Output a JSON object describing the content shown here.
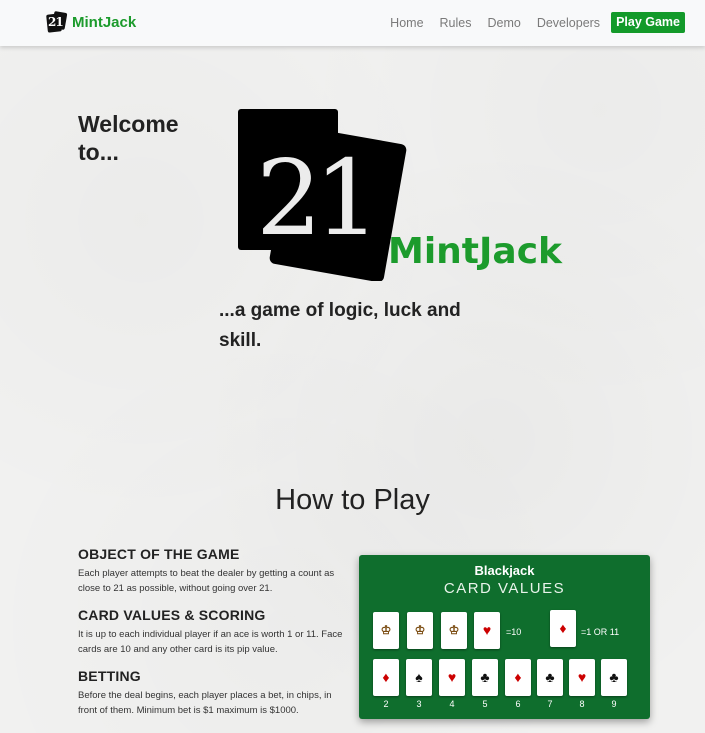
{
  "navbar": {
    "brand_logo_text": "21",
    "brand_name": "MintJack",
    "links": [
      "Home",
      "Rules",
      "Demo",
      "Developers"
    ],
    "cta": "Play Game"
  },
  "hero": {
    "welcome": "Welcome to...",
    "logo_number": "21",
    "logo_name": "MintJack",
    "tagline": "...a game of logic, luck and skill."
  },
  "how_to_play": {
    "title": "How to Play",
    "rules": [
      {
        "heading": "OBJECT OF THE GAME",
        "text": "Each player attempts to beat the dealer by getting a count as close to 21 as possible, without going over 21."
      },
      {
        "heading": "CARD VALUES & SCORING",
        "text": "It is up to each individual player if an ace is worth 1 or 11. Face cards are 10 and any other card is its pip value."
      },
      {
        "heading": "BETTING",
        "text": "Before the deal begins, each player places a bet, in chips, in front of them. Minimum bet is $1 maximum is $1000."
      }
    ]
  },
  "card_panel": {
    "title": "Blackjack",
    "subtitle": "CARD VALUES",
    "face_value_label": "=10",
    "ace_value_label": "=1 OR 11",
    "pip_labels": [
      "2",
      "3",
      "4",
      "5",
      "6",
      "7",
      "8",
      "9"
    ],
    "colors": {
      "panel": "#0f6e2d",
      "brand_green": "#1c9b2c"
    }
  }
}
